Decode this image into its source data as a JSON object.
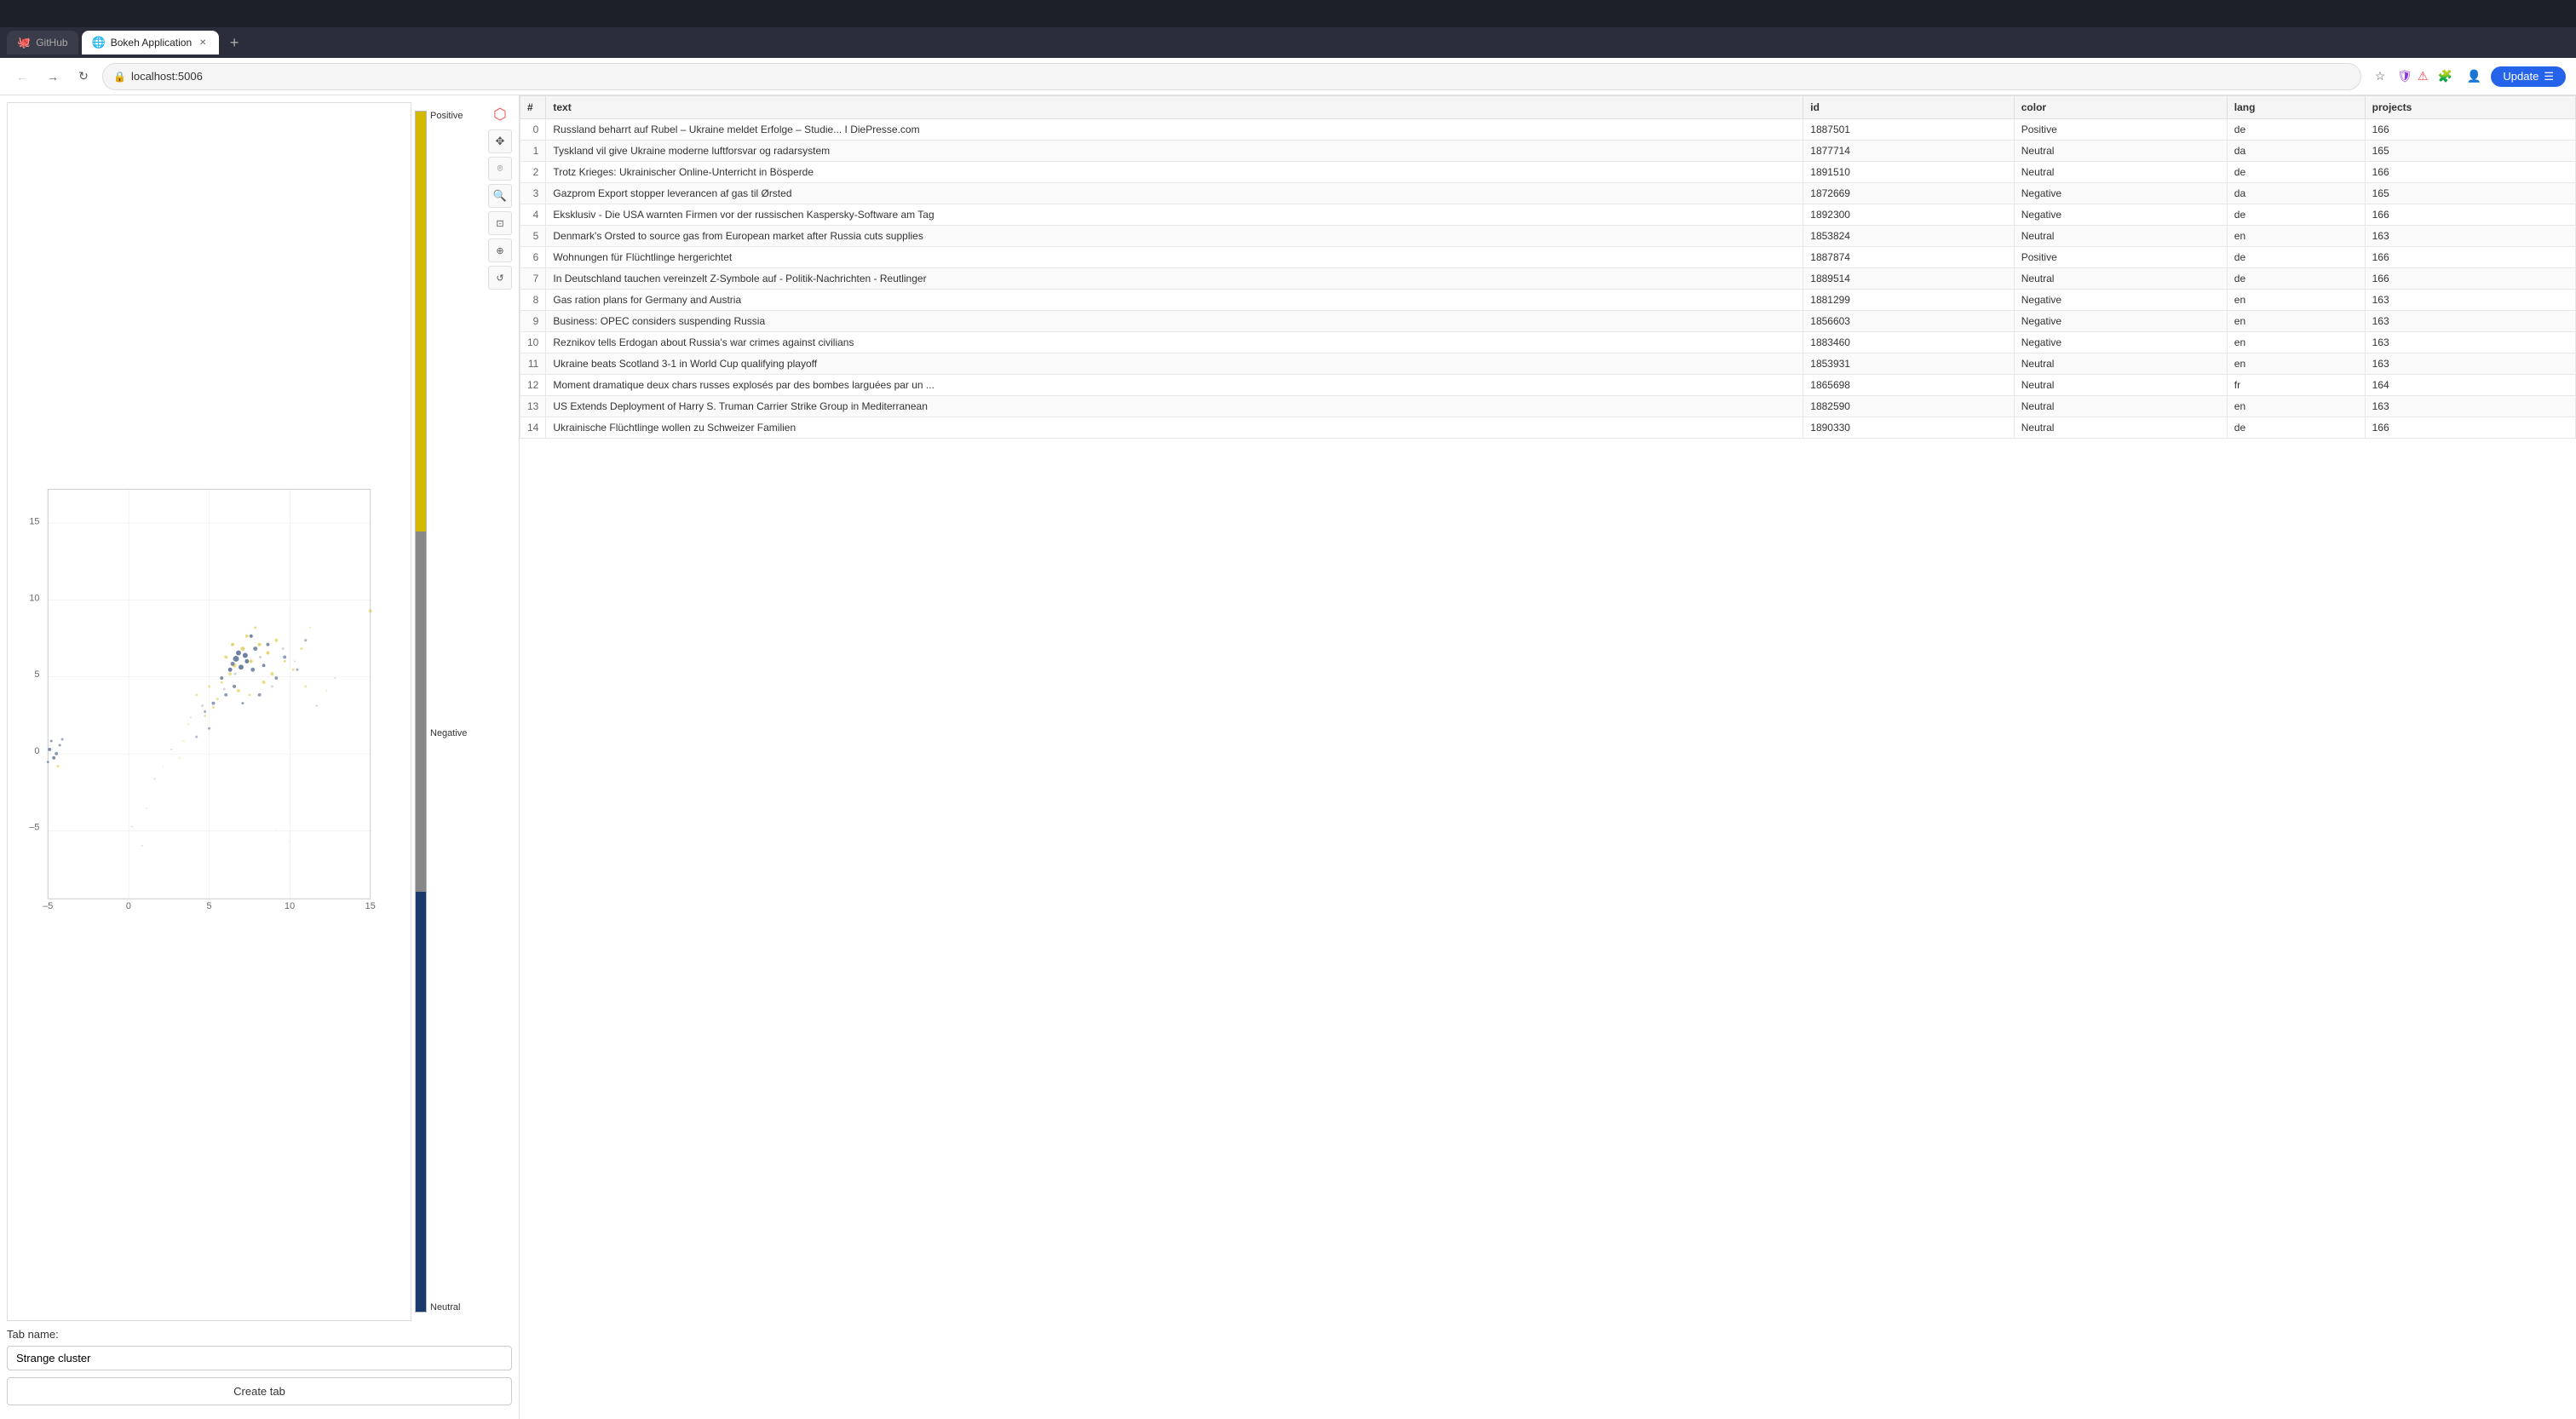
{
  "browser": {
    "tabs": [
      {
        "id": "github",
        "label": "GitHub",
        "active": false,
        "favicon": "🐙"
      },
      {
        "id": "bokeh",
        "label": "Bokeh Application",
        "active": true,
        "favicon": "🌐"
      }
    ],
    "new_tab_label": "+",
    "address": "localhost:5006",
    "update_btn_label": "Update"
  },
  "toolbar_tools": [
    {
      "id": "logo",
      "icon": "⬡",
      "title": "Bokeh"
    },
    {
      "id": "pan",
      "icon": "✥",
      "title": "Pan"
    },
    {
      "id": "lasso",
      "icon": "⌾",
      "title": "Lasso Select"
    },
    {
      "id": "zoom",
      "icon": "🔍",
      "title": "Zoom"
    },
    {
      "id": "add",
      "icon": "⊞",
      "title": "Add"
    },
    {
      "id": "link",
      "icon": "⬡",
      "title": "Link"
    },
    {
      "id": "refresh",
      "icon": "↺",
      "title": "Refresh"
    }
  ],
  "legend": {
    "positive_label": "Positive",
    "negative_label": "Negative",
    "neutral_label": "Neutral"
  },
  "bottom_form": {
    "tab_name_label": "Tab name:",
    "tab_name_placeholder": "",
    "tab_name_value": "Strange cluster",
    "create_btn_label": "Create tab"
  },
  "table": {
    "columns": [
      "#",
      "text",
      "id",
      "color",
      "lang",
      "projects"
    ],
    "rows": [
      {
        "num": 0,
        "text": "Russland beharrt auf Rubel – Ukraine meldet Erfolge – Studie... I DiePresse.com",
        "id": "1887501",
        "color": "Positive",
        "lang": "de",
        "projects": "166"
      },
      {
        "num": 1,
        "text": "Tyskland vil give Ukraine moderne luftforsvar og radarsystem",
        "id": "1877714",
        "color": "Neutral",
        "lang": "da",
        "projects": "165"
      },
      {
        "num": 2,
        "text": "Trotz Krieges: Ukrainischer Online-Unterricht in Bösperde",
        "id": "1891510",
        "color": "Neutral",
        "lang": "de",
        "projects": "166"
      },
      {
        "num": 3,
        "text": "Gazprom Export stopper leverancen af gas til Ørsted",
        "id": "1872669",
        "color": "Negative",
        "lang": "da",
        "projects": "165"
      },
      {
        "num": 4,
        "text": "Eksklusiv - Die USA warnten Firmen vor der russischen Kaspersky-Software am Tag",
        "id": "1892300",
        "color": "Negative",
        "lang": "de",
        "projects": "166"
      },
      {
        "num": 5,
        "text": "Denmark's Orsted to source gas from European market after Russia cuts supplies",
        "id": "1853824",
        "color": "Neutral",
        "lang": "en",
        "projects": "163"
      },
      {
        "num": 6,
        "text": "Wohnungen für Flüchtlinge hergerichtet",
        "id": "1887874",
        "color": "Positive",
        "lang": "de",
        "projects": "166"
      },
      {
        "num": 7,
        "text": "In Deutschland tauchen vereinzelt Z-Symbole auf - Politik-Nachrichten - Reutlinger",
        "id": "1889514",
        "color": "Neutral",
        "lang": "de",
        "projects": "166"
      },
      {
        "num": 8,
        "text": "Gas ration plans for Germany and Austria",
        "id": "1881299",
        "color": "Negative",
        "lang": "en",
        "projects": "163"
      },
      {
        "num": 9,
        "text": "Business: OPEC considers suspending Russia",
        "id": "1856603",
        "color": "Negative",
        "lang": "en",
        "projects": "163"
      },
      {
        "num": 10,
        "text": "Reznikov tells Erdogan about Russia's war crimes against civilians",
        "id": "1883460",
        "color": "Negative",
        "lang": "en",
        "projects": "163"
      },
      {
        "num": 11,
        "text": "Ukraine beats Scotland 3-1 in World Cup qualifying playoff",
        "id": "1853931",
        "color": "Neutral",
        "lang": "en",
        "projects": "163"
      },
      {
        "num": 12,
        "text": "Moment dramatique deux chars russes explosés par des bombes larguées par un ...",
        "id": "1865698",
        "color": "Neutral",
        "lang": "fr",
        "projects": "164"
      },
      {
        "num": 13,
        "text": "US Extends Deployment of Harry S. Truman Carrier Strike Group in Mediterranean",
        "id": "1882590",
        "color": "Neutral",
        "lang": "en",
        "projects": "163"
      },
      {
        "num": 14,
        "text": "Ukrainische Flüchtlinge wollen zu Schweizer Familien",
        "id": "1890330",
        "color": "Neutral",
        "lang": "de",
        "projects": "166"
      }
    ]
  },
  "plot": {
    "x_ticks": [
      "-5",
      "0",
      "5",
      "10",
      "15"
    ],
    "y_ticks": [
      "-5",
      "0",
      "5",
      "10",
      "15"
    ],
    "x_center": 5,
    "y_center": 7
  }
}
